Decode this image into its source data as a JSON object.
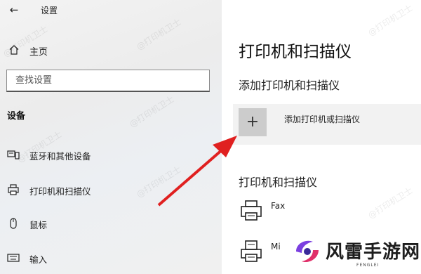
{
  "app": {
    "title": "设置"
  },
  "sidebar": {
    "home_label": "主页",
    "search_placeholder": "查找设置",
    "section_title": "设备",
    "items": [
      {
        "label": "蓝牙和其他设备",
        "icon": "bluetooth-devices-icon"
      },
      {
        "label": "打印机和扫描仪",
        "icon": "printer-icon"
      },
      {
        "label": "鼠标",
        "icon": "mouse-icon"
      },
      {
        "label": "输入",
        "icon": "keyboard-icon"
      }
    ]
  },
  "main": {
    "title": "打印机和扫描仪",
    "add_section_title": "添加打印机和扫描仪",
    "add_button_label": "添加打印机或扫描仪",
    "list_title": "打印机和扫描仪",
    "printers": [
      {
        "name": "Fax",
        "icon": "fax-printer-icon"
      },
      {
        "name": "Mi",
        "icon": "document-printer-icon"
      }
    ]
  },
  "watermark": {
    "text": "@打印机卫士"
  },
  "logo": {
    "text": "风雷手游网",
    "sub": "FENGLEI"
  },
  "colors": {
    "arrow": "#e02020",
    "add_tile": "#cccccc",
    "sidebar_bg": "#efefef"
  }
}
